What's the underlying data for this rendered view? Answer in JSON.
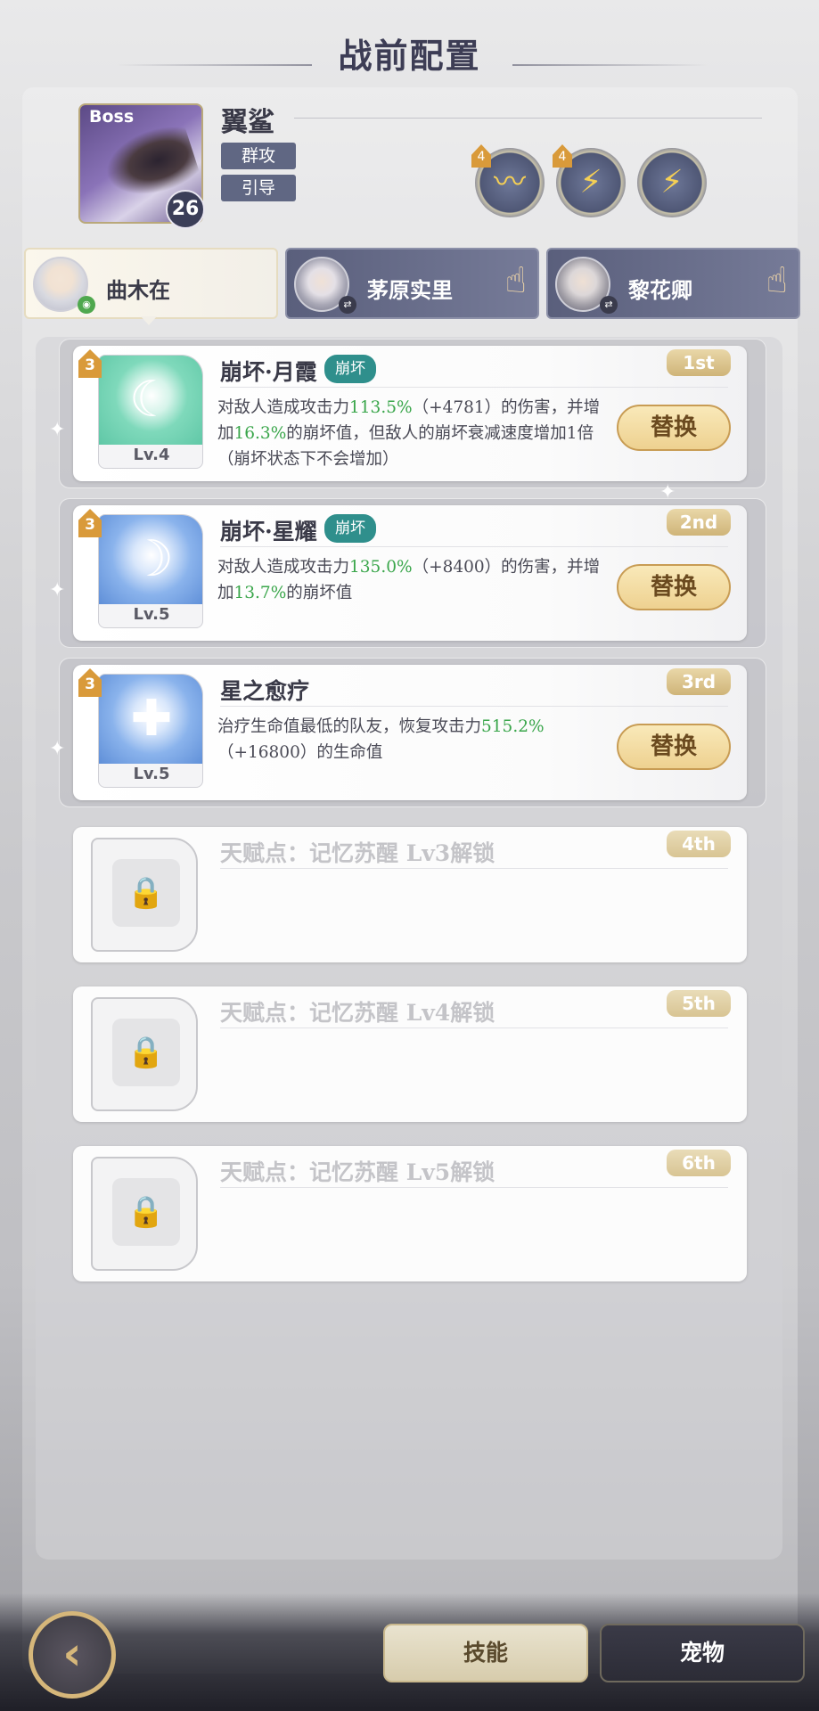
{
  "title": "战前配置",
  "boss": {
    "badge": "Boss",
    "level": "26",
    "name": "翼鲨",
    "tags": [
      "群攻",
      "引导"
    ],
    "element_icons": [
      {
        "icon": "wind-slash-icon",
        "badge": "4"
      },
      {
        "icon": "lightning-icon",
        "badge": "4"
      },
      {
        "icon": "lightning-icon",
        "badge": ""
      }
    ]
  },
  "characters": [
    {
      "name": "曲木在",
      "active": true
    },
    {
      "name": "茅原实里",
      "active": false
    },
    {
      "name": "黎花卿",
      "active": false
    }
  ],
  "skills": [
    {
      "slot": "1st",
      "rank": "3",
      "name": "崩坏·月霞",
      "tag": "崩坏",
      "level": "Lv.4",
      "desc_parts": [
        "对敌人造成攻击力",
        "113.5%",
        "（+4781）的伤害，并增加",
        "16.3%",
        "的崩坏值，但敌人的崩坏衰减速度增加1倍（崩坏状态下不会增加）"
      ],
      "button": "替换"
    },
    {
      "slot": "2nd",
      "rank": "3",
      "name": "崩坏·星耀",
      "tag": "崩坏",
      "level": "Lv.5",
      "desc_parts": [
        "对敌人造成攻击力",
        "135.0%",
        "（+8400）的伤害，并增加",
        "13.7%",
        "的崩坏值"
      ],
      "button": "替换"
    },
    {
      "slot": "3rd",
      "rank": "3",
      "name": "星之愈疗",
      "tag": "",
      "level": "Lv.5",
      "desc_parts": [
        "治疗生命值最低的队友，恢复攻击力",
        "515.2%",
        "（+16800）的生命值"
      ],
      "button": "替换"
    }
  ],
  "locked_slots": [
    {
      "slot": "4th",
      "text": "天赋点：记忆苏醒 Lv3解锁"
    },
    {
      "slot": "5th",
      "text": "天赋点：记忆苏醒 Lv4解锁"
    },
    {
      "slot": "6th",
      "text": "天赋点：记忆苏醒 Lv5解锁"
    }
  ],
  "bottom": {
    "skill_button": "技能",
    "pet_button": "宠物"
  },
  "colors": {
    "highlight": "#3aa64b",
    "tag_teal": "#2f8f8c",
    "gold": "#d6b77a"
  }
}
